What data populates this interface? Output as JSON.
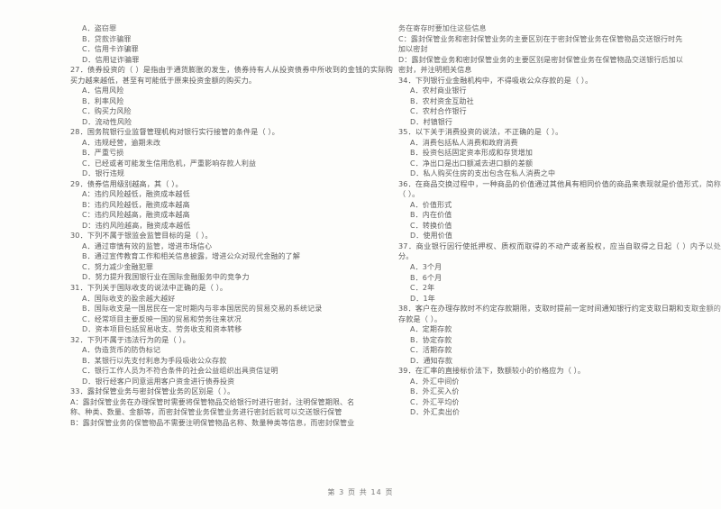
{
  "document": {
    "type": "exam-paper",
    "footer": "第 3 页  共 14 页"
  },
  "left_column": {
    "blocks": [
      {
        "kind": "option",
        "text": "A．盗窃罪"
      },
      {
        "kind": "option",
        "text": "B．贷款诈骗罪"
      },
      {
        "kind": "option",
        "text": "C．信用卡诈骗罪"
      },
      {
        "kind": "option",
        "text": "D．信用证诈骗罪"
      },
      {
        "kind": "stem",
        "text": "27．债券投资的（      ）是指由于通货膨胀的发生，债券持有人从投资债券中所收到的金钱的实际购买力越来越低，甚至有可能低于原来投资金额的购买力。"
      },
      {
        "kind": "option",
        "text": "A．信用风险"
      },
      {
        "kind": "option",
        "text": "B．利率风险"
      },
      {
        "kind": "option",
        "text": "C．购买力风险"
      },
      {
        "kind": "option",
        "text": "D．流动性风险"
      },
      {
        "kind": "stem",
        "text": "28．国务院银行业监督管理机构对银行实行接管的条件是（      ）。"
      },
      {
        "kind": "option",
        "text": "A．违规经营，逾期未改"
      },
      {
        "kind": "option",
        "text": "B．严重亏损"
      },
      {
        "kind": "option",
        "text": "C．已经或者可能发生信用危机，严重影响存款人利益"
      },
      {
        "kind": "option",
        "text": "D．银行违规"
      },
      {
        "kind": "stem",
        "text": "29．债券信用级别越高，其（      ）。"
      },
      {
        "kind": "option",
        "text": "A：违约风险越低，融资成本越低"
      },
      {
        "kind": "option",
        "text": "B：违约风险越低，融资成本越高"
      },
      {
        "kind": "option",
        "text": "C：违约风险越高，融资成本越高"
      },
      {
        "kind": "option",
        "text": "D：违约风险越高，融资成本越低"
      },
      {
        "kind": "stem",
        "text": "30．下列不属于银监会监管目标的是（      ）。"
      },
      {
        "kind": "option",
        "text": "A．通过审慎有效的监管，增进市场信心"
      },
      {
        "kind": "option",
        "text": "B．通过宣传教育工作和相关信息披露，增进公众对现代金融的了解"
      },
      {
        "kind": "option",
        "text": "C．努力减少金融犯罪"
      },
      {
        "kind": "option",
        "text": "D．努力提升我国银行业在国际金融服务中的竞争力"
      },
      {
        "kind": "stem",
        "text": "31．下列关于国际收支的说法中正确的是（      ）。"
      },
      {
        "kind": "option",
        "text": "A．国际收支的盈余越大越好"
      },
      {
        "kind": "option",
        "text": "B．国际收支是一国居民在一定时期内与非本国居民的贸易交易的系统记录"
      },
      {
        "kind": "option",
        "text": "C．经常项目主要反映一国的贸易和劳务往来状况"
      },
      {
        "kind": "option",
        "text": "D．资本项目包括贸易收支、劳务收支和资本转移"
      },
      {
        "kind": "stem",
        "text": "32．下列不属于违法行为的是（      ）。"
      },
      {
        "kind": "option",
        "text": "A．伪造货币的防伪标记"
      },
      {
        "kind": "option",
        "text": "B．某银行以先支付利息为手段吸收公众存款"
      },
      {
        "kind": "option",
        "text": "C．银行工作人员为不符合条件的社会公益组织出具资信证明"
      },
      {
        "kind": "option",
        "text": "D．银行经客户同意运用客户资金进行债券投资"
      },
      {
        "kind": "stem",
        "text": "33．露封保管业务与密封保管业务的区别是（      ）。"
      },
      {
        "kind": "option-hang",
        "text": "A：露封保管业务在办理保管时需要将保管物品交给银行时进行密封，注明保管期限、名"
      },
      {
        "kind": "option-cont",
        "text": "称、种类、数量、金额等，而密封保管业务保管业务进行密封后就可以交送银行保管"
      },
      {
        "kind": "option-hang",
        "text": "B：露封保管业务的保管物品不需要注明保管物品名称、数量种类等信息，而密封保管业"
      }
    ]
  },
  "right_column": {
    "blocks": [
      {
        "kind": "option-cont",
        "text": "务在寄存时要加住这些信息"
      },
      {
        "kind": "option-hang",
        "text": "C：露封保管业务和密封保管业务的主要区别在于密封保管业务在保管物品交送银行时先"
      },
      {
        "kind": "option-cont",
        "text": "加以密封"
      },
      {
        "kind": "option-hang",
        "text": "D：露封保管业务和密封保管业务的主要区别是密封保管业务在保管物品交送银行后加以"
      },
      {
        "kind": "option-cont",
        "text": "密封，并注明相关信息"
      },
      {
        "kind": "stem",
        "text": "34．下列银行业金融机构中，不得吸收公众存款的是（      ）。"
      },
      {
        "kind": "option",
        "text": "A．农村商业银行"
      },
      {
        "kind": "option",
        "text": "B．农村资金互助社"
      },
      {
        "kind": "option",
        "text": "C．农村合作银行"
      },
      {
        "kind": "option",
        "text": "D．村镇银行"
      },
      {
        "kind": "stem",
        "text": "35．以下关于消费投资的说法，不正确的是（      ）。"
      },
      {
        "kind": "option",
        "text": "A．消费包括私人消费和政府消费"
      },
      {
        "kind": "option",
        "text": "B．投资包括固定资本形成和存货增加"
      },
      {
        "kind": "option",
        "text": "C．净出口是出口额减去进口额的差额"
      },
      {
        "kind": "option",
        "text": "D．私人购买住房的支出包含在私人消费之中"
      },
      {
        "kind": "stem",
        "text": "36．在商品交换过程中，一种商品的价值通过其他具有相同价值的商品来表现就是价值形式，简称（      ）。"
      },
      {
        "kind": "option",
        "text": "A．价值形式"
      },
      {
        "kind": "option",
        "text": "B．内在价值"
      },
      {
        "kind": "option",
        "text": "C．转换价值"
      },
      {
        "kind": "option",
        "text": "D．使用价值"
      },
      {
        "kind": "stem",
        "text": "37．商业银行因行使抵押权、质权而取得的不动产或者股权，应当自取得之日起（      ）内予以处分。"
      },
      {
        "kind": "option",
        "text": "A．3个月"
      },
      {
        "kind": "option",
        "text": "B．6个月"
      },
      {
        "kind": "option",
        "text": "C．2年"
      },
      {
        "kind": "option",
        "text": "D．1年"
      },
      {
        "kind": "stem",
        "text": "38．客户在办理存款时不约定存款期限，支取时提前一定时间通知银行约定支取日期和支取金额的存款是（      ）。"
      },
      {
        "kind": "option",
        "text": "A．定期存款"
      },
      {
        "kind": "option",
        "text": "B．协定存款"
      },
      {
        "kind": "option",
        "text": "C．活期存款"
      },
      {
        "kind": "option",
        "text": "D．通知存款"
      },
      {
        "kind": "stem",
        "text": "39．在汇率的直接标价法下，数额较小的价格应为（      ）。"
      },
      {
        "kind": "option",
        "text": "A．外汇中间价"
      },
      {
        "kind": "option",
        "text": "B．外汇买入价"
      },
      {
        "kind": "option",
        "text": "C．外汇平均价"
      },
      {
        "kind": "option",
        "text": "D．外汇卖出价"
      }
    ]
  }
}
